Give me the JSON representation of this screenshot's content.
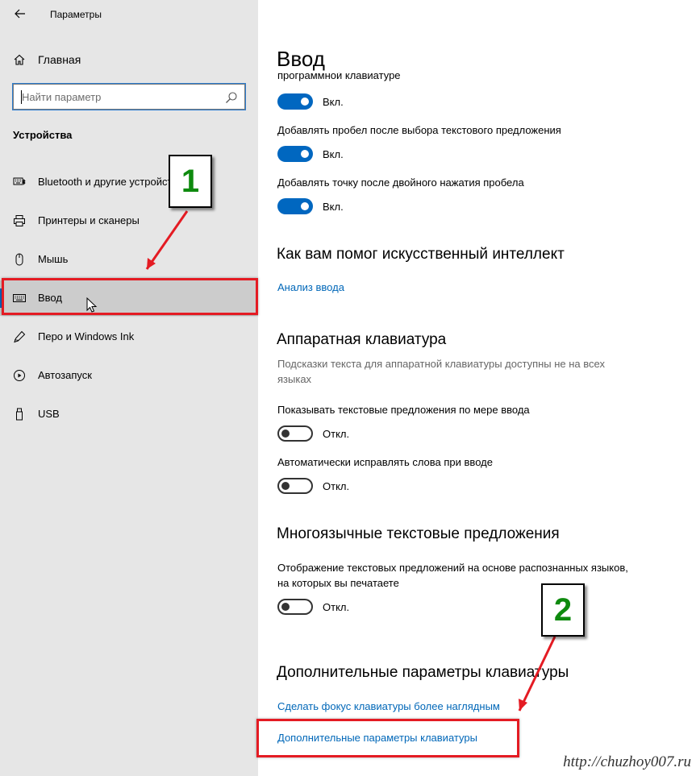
{
  "window": {
    "title": "Параметры"
  },
  "sidebar": {
    "home_label": "Главная",
    "search_placeholder": "Найти параметр",
    "section_title": "Устройства",
    "items": [
      {
        "label": "Bluetooth и другие устройства",
        "icon": "bluetooth-keyboard-icon",
        "active": false
      },
      {
        "label": "Принтеры и сканеры",
        "icon": "printer-icon",
        "active": false
      },
      {
        "label": "Мышь",
        "icon": "mouse-icon",
        "active": false
      },
      {
        "label": "Ввод",
        "icon": "keyboard-icon",
        "active": true
      },
      {
        "label": "Перо и Windows Ink",
        "icon": "pen-icon",
        "active": false
      },
      {
        "label": "Автозапуск",
        "icon": "autoplay-icon",
        "active": false
      },
      {
        "label": "USB",
        "icon": "usb-icon",
        "active": false
      }
    ]
  },
  "main": {
    "title": "Ввод",
    "clipped_text": "программной клавиатуре",
    "toggles_top": [
      {
        "state": "Вкл."
      },
      {
        "label": "Добавлять пробел после выбора текстового предложения",
        "state": "Вкл."
      },
      {
        "label": "Добавлять точку после двойного нажатия пробела",
        "state": "Вкл."
      }
    ],
    "ai_section": {
      "title": "Как вам помог искусственный интеллект",
      "link": "Анализ ввода"
    },
    "hw_section": {
      "title": "Аппаратная клавиатура",
      "desc": "Подсказки текста для аппаратной клавиатуры доступны не на всех языках",
      "settings": [
        {
          "label": "Показывать текстовые предложения по мере ввода",
          "state": "Откл."
        },
        {
          "label": "Автоматически исправлять слова при вводе",
          "state": "Откл."
        }
      ]
    },
    "multi_section": {
      "title": "Многоязычные текстовые предложения",
      "label": "Отображение текстовых предложений на основе распознанных языков, на которых вы печатаете",
      "state": "Откл."
    },
    "adv_section": {
      "title": "Дополнительные параметры клавиатуры",
      "link1": "Сделать фокус клавиатуры более наглядным",
      "link2": "Дополнительные параметры клавиатуры"
    }
  },
  "annotations": {
    "marker1": "1",
    "marker2": "2",
    "highlight_color": "#e41b23",
    "marker_color": "#0e8a0e"
  },
  "watermark": "http://chuzhoy007.ru"
}
